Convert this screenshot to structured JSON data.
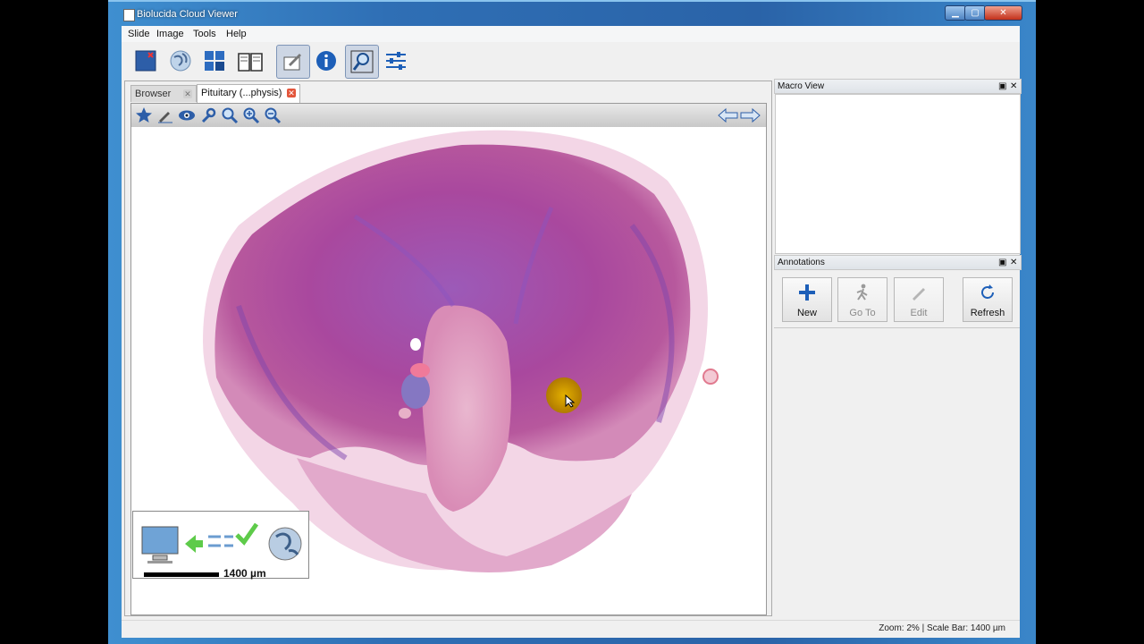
{
  "window": {
    "title": "Biolucida Cloud Viewer",
    "min": "▁",
    "max": "▢",
    "close": "✕"
  },
  "menu": [
    "Slide",
    "Image",
    "Tools",
    "Help"
  ],
  "toolbar_icons": [
    "slide-icon",
    "globe-icon",
    "tiles-icon",
    "book-icon",
    "annotate-icon",
    "info-icon",
    "magnifier-icon",
    "sliders-icon"
  ],
  "tabs": {
    "browser": "Browser",
    "slide": "Pituitary (...physis)",
    "close": "✕"
  },
  "viewer_tools": [
    "star-icon",
    "pen-icon",
    "eye-icon",
    "wrench-icon",
    "zoom-icon",
    "zoom-in-icon",
    "zoom-out-icon"
  ],
  "scalebar": {
    "label": "1400 µm"
  },
  "macro_view": {
    "title": "Macro View"
  },
  "annotations": {
    "title": "Annotations",
    "buttons": {
      "new": "New",
      "goto": "Go To",
      "edit": "Edit",
      "refresh": "Refresh"
    }
  },
  "status": "Zoom: 2% | Scale Bar: 1400 µm",
  "colors": {
    "accent": "#2a63a8",
    "tissue_pink": "#c86aa8",
    "tissue_purple": "#8a4fb0",
    "highlight": "#d4a300"
  }
}
